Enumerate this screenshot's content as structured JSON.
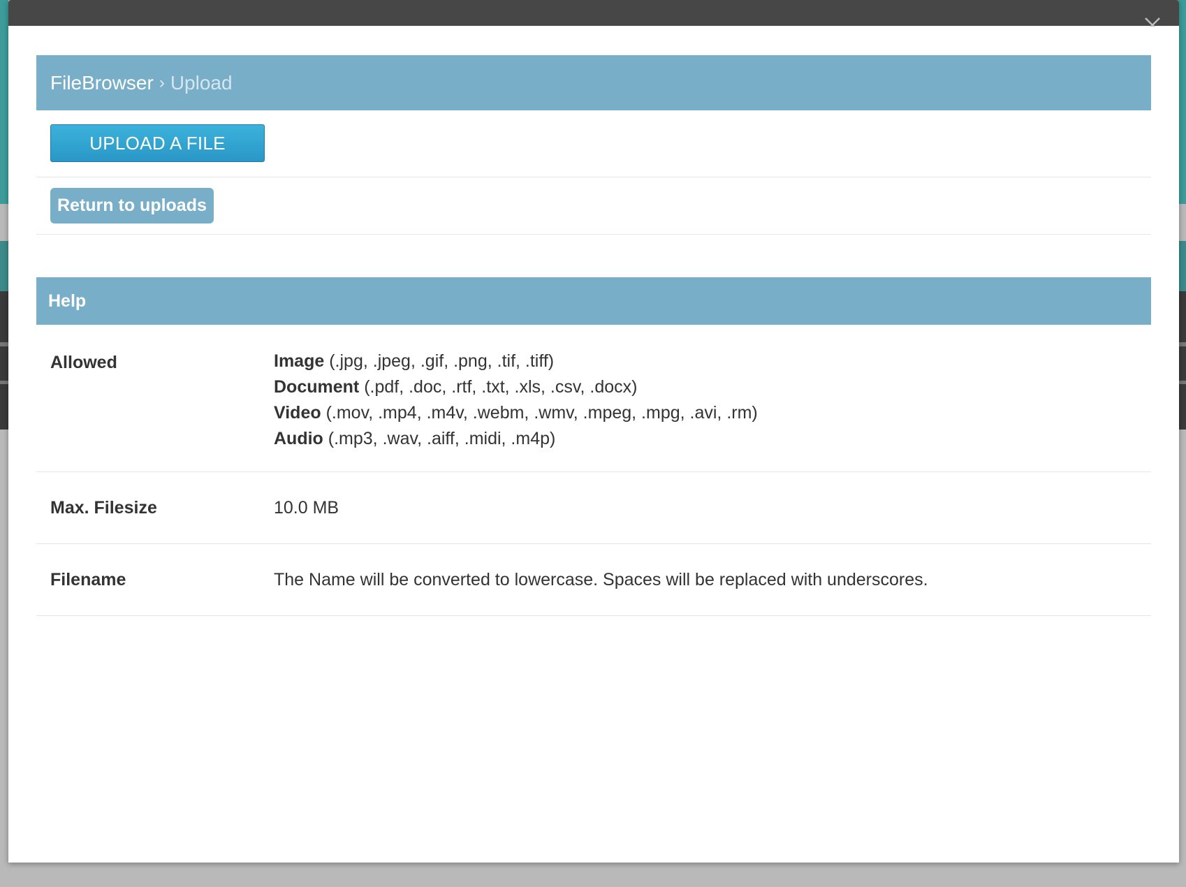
{
  "breadcrumb": {
    "root": "FileBrowser",
    "separator": "›",
    "current": "Upload"
  },
  "actions": {
    "upload_label": "UPLOAD A FILE",
    "return_label": "Return to uploads"
  },
  "help": {
    "title": "Help",
    "allowed": {
      "label": "Allowed",
      "types": [
        {
          "name": "Image",
          "extensions": "(.jpg, .jpeg, .gif, .png, .tif, .tiff)"
        },
        {
          "name": "Document",
          "extensions": "(.pdf, .doc, .rtf, .txt, .xls, .csv, .docx)"
        },
        {
          "name": "Video",
          "extensions": "(.mov, .mp4, .m4v, .webm, .wmv, .mpeg, .mpg, .avi, .rm)"
        },
        {
          "name": "Audio",
          "extensions": "(.mp3, .wav, .aiff, .midi, .m4p)"
        }
      ]
    },
    "max_filesize": {
      "label": "Max. Filesize",
      "value": "10.0 MB"
    },
    "filename": {
      "label": "Filename",
      "value": "The Name will be converted to lowercase. Spaces will be replaced with underscores."
    }
  },
  "colors": {
    "header_bg": "#79aec8",
    "upload_button": "#2fa3d0",
    "titlebar": "#474747"
  },
  "icons": {
    "close": "close-icon"
  }
}
